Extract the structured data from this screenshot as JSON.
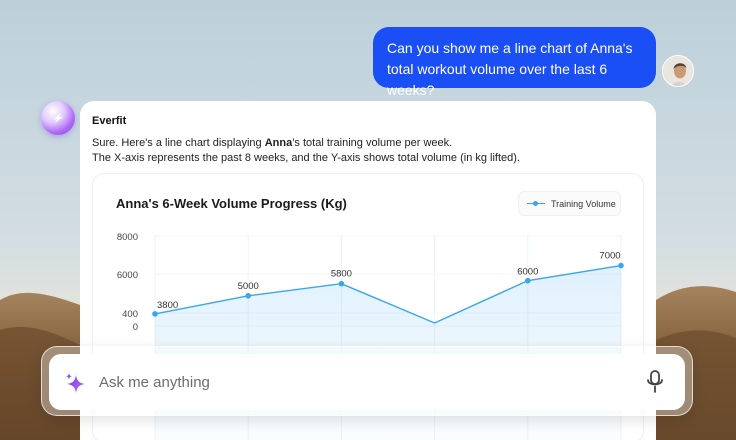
{
  "user_message": {
    "text": "Can you show me a line chart of Anna's total workout volume over the last 6 weeks?"
  },
  "bot": {
    "name": "Everfit",
    "intro_prefix": "Sure. Here's a line chart displaying ",
    "intro_bold": "Anna",
    "intro_suffix": "’s total training volume per week.",
    "intro_line2": "The X-axis represents the past 8 weeks, and the Y-axis shows total volume (in kg lifted)."
  },
  "chart_data": {
    "type": "line",
    "title": "Anna's 6-Week Volume Progress (Kg)",
    "legend": "Training Volume",
    "legend_position": "top-right",
    "grid": true,
    "y_ticks": [
      "8000",
      "6000",
      "400",
      "0"
    ],
    "series": [
      {
        "name": "Training Volume",
        "color": "#3aa5ef",
        "values": [
          3800,
          5000,
          5800,
          3200,
          6000,
          7000
        ],
        "labels": [
          "3800",
          "5000",
          "5800",
          "",
          "6000",
          "7000"
        ]
      }
    ]
  },
  "search": {
    "placeholder": "Ask me anything"
  },
  "icons": {
    "input_left": "sparkle-icon",
    "input_right": "microphone-icon",
    "bot": "everfit-logo-icon"
  },
  "colors": {
    "user_bubble": "#1a4ff5",
    "series": "#3aa5ef",
    "sparkle_start": "#7b3df0",
    "sparkle_end": "#c36af2"
  }
}
